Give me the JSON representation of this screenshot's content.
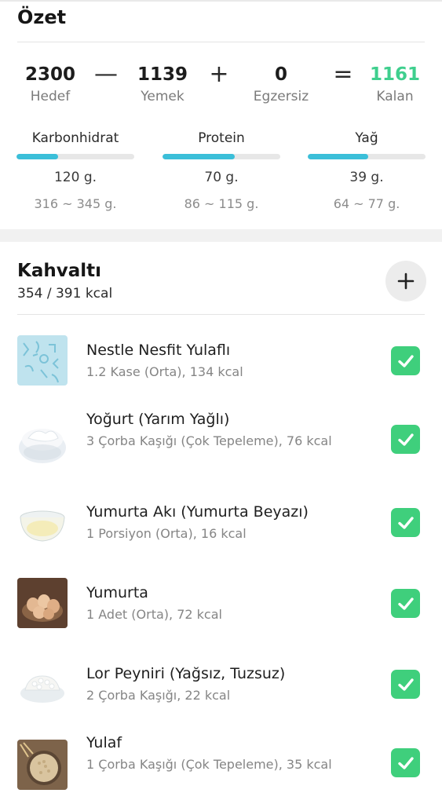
{
  "summary": {
    "title": "Özet",
    "calc": {
      "goal": {
        "value": "2300",
        "label": "Hedef"
      },
      "op1": "—",
      "food": {
        "value": "1139",
        "label": "Yemek"
      },
      "op2": "+",
      "exercise": {
        "value": "0",
        "label": "Egzersiz"
      },
      "op3": "=",
      "remaining": {
        "value": "1161",
        "label": "Kalan",
        "color": "#3fcf8e"
      }
    },
    "macros": [
      {
        "name": "Karbonhidrat",
        "grams": "120 g.",
        "range": "316 ~ 345 g.",
        "progress": 0.35,
        "color": "#3bbfd9"
      },
      {
        "name": "Protein",
        "grams": "70 g.",
        "range": "86 ~ 115 g.",
        "progress": 0.61,
        "color": "#3bbfd9"
      },
      {
        "name": "Yağ",
        "grams": "39 g.",
        "range": "64 ~ 77 g.",
        "progress": 0.51,
        "color": "#3bbfd9"
      }
    ]
  },
  "meal": {
    "title": "Kahvaltı",
    "kcal": "354 / 391 kcal",
    "add_icon": "plus-icon",
    "items": [
      {
        "name": "Nestle Nesfit Yulaflı",
        "desc": "1.2 Kase (Orta), 134 kcal",
        "checked": true
      },
      {
        "name": "Yoğurt (Yarım Yağlı)",
        "desc": "3 Çorba Kaşığı (Çok Tepeleme), 76 kcal",
        "checked": true
      },
      {
        "name": "Yumurta Akı (Yumurta Beyazı)",
        "desc": "1 Porsiyon (Orta), 16 kcal",
        "checked": true
      },
      {
        "name": "Yumurta",
        "desc": "1 Adet (Orta), 72 kcal",
        "checked": true
      },
      {
        "name": "Lor Peyniri (Yağsız, Tuzsuz)",
        "desc": "2 Çorba Kaşığı, 22 kcal",
        "checked": true
      },
      {
        "name": "Yulaf",
        "desc": "1 Çorba Kaşığı (Çok Tepeleme), 35 kcal",
        "checked": true
      }
    ]
  }
}
